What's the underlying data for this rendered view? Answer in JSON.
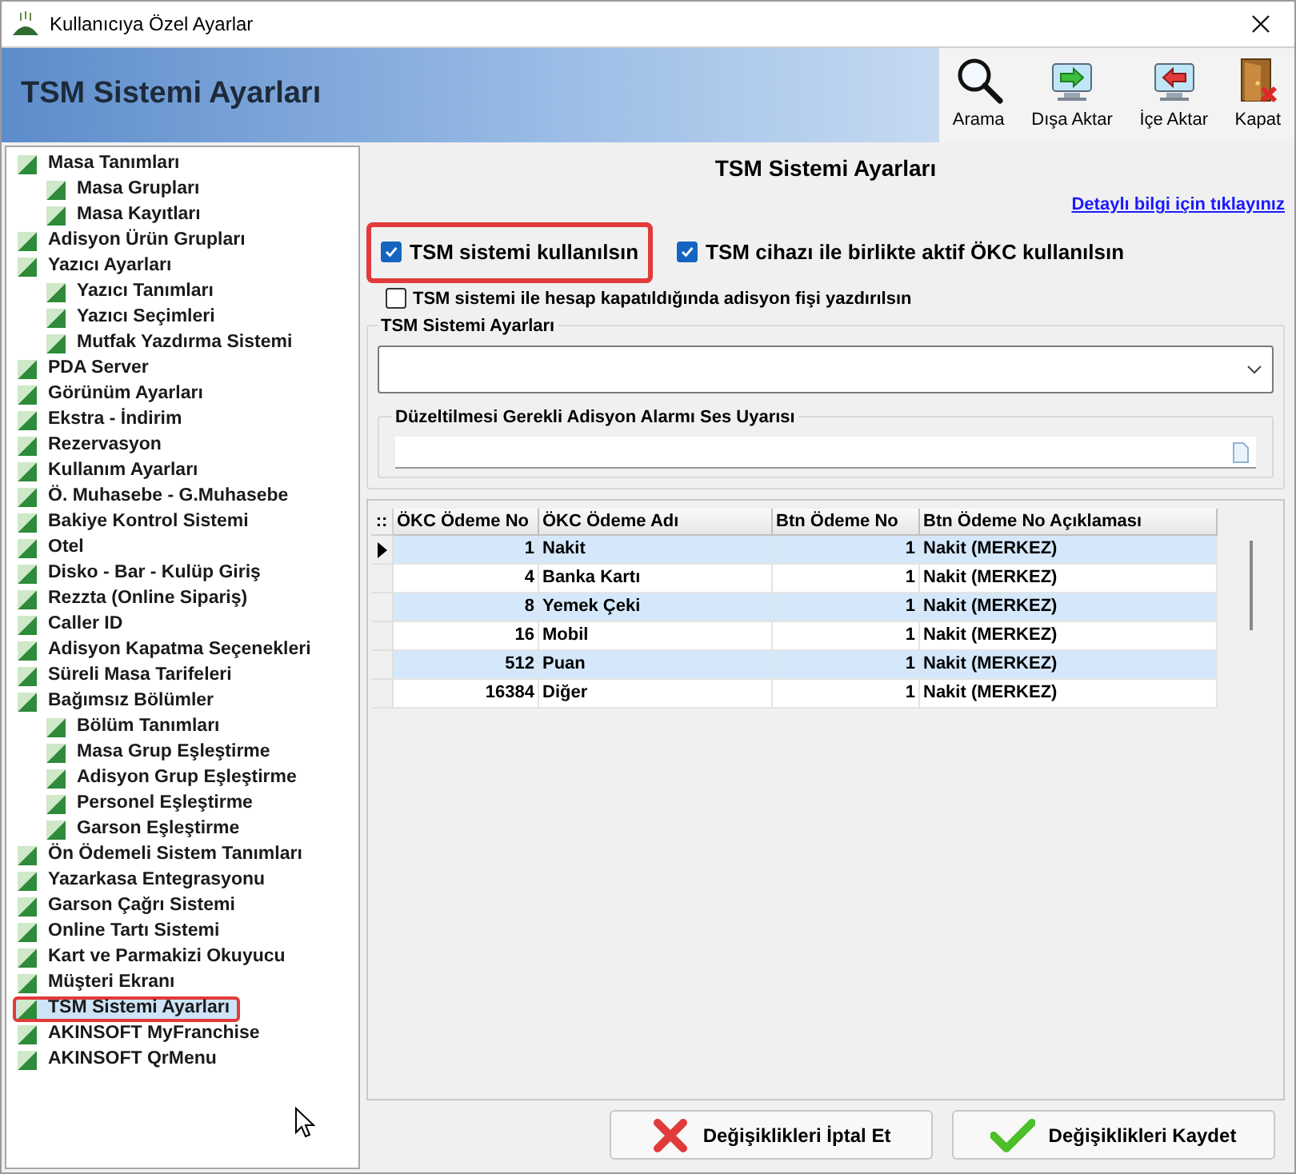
{
  "window": {
    "title": "Kullanıcıya Özel Ayarlar"
  },
  "header": {
    "title": "TSM Sistemi Ayarları"
  },
  "toolbar": [
    {
      "kind": "search",
      "label": "Arama"
    },
    {
      "kind": "export",
      "label": "Dışa Aktar"
    },
    {
      "kind": "import",
      "label": "İçe Aktar"
    },
    {
      "kind": "close",
      "label": "Kapat"
    }
  ],
  "sidebar": {
    "items": [
      {
        "label": "Masa Tanımları",
        "selected": false,
        "children": [
          {
            "label": "Masa Grupları",
            "selected": false
          },
          {
            "label": "Masa Kayıtları",
            "selected": false
          }
        ]
      },
      {
        "label": "Adisyon Ürün Grupları",
        "selected": false
      },
      {
        "label": "Yazıcı Ayarları",
        "selected": false,
        "children": [
          {
            "label": "Yazıcı Tanımları",
            "selected": false
          },
          {
            "label": "Yazıcı Seçimleri",
            "selected": false
          },
          {
            "label": "Mutfak Yazdırma Sistemi",
            "selected": false
          }
        ]
      },
      {
        "label": "PDA Server",
        "selected": false
      },
      {
        "label": "Görünüm Ayarları",
        "selected": false
      },
      {
        "label": "Ekstra - İndirim",
        "selected": false
      },
      {
        "label": "Rezervasyon",
        "selected": false
      },
      {
        "label": "Kullanım Ayarları",
        "selected": false
      },
      {
        "label": "Ö. Muhasebe - G.Muhasebe",
        "selected": false
      },
      {
        "label": "Bakiye Kontrol Sistemi",
        "selected": false
      },
      {
        "label": "Otel",
        "selected": false
      },
      {
        "label": "Disko - Bar - Kulüp Giriş",
        "selected": false
      },
      {
        "label": "Rezzta (Online Sipariş)",
        "selected": false
      },
      {
        "label": "Caller ID",
        "selected": false
      },
      {
        "label": "Adisyon Kapatma Seçenekleri",
        "selected": false
      },
      {
        "label": "Süreli Masa Tarifeleri",
        "selected": false
      },
      {
        "label": "Bağımsız Bölümler",
        "selected": false,
        "children": [
          {
            "label": "Bölüm Tanımları",
            "selected": false
          },
          {
            "label": "Masa Grup Eşleştirme",
            "selected": false
          },
          {
            "label": "Adisyon Grup Eşleştirme",
            "selected": false
          },
          {
            "label": "Personel Eşleştirme",
            "selected": false
          },
          {
            "label": "Garson Eşleştirme",
            "selected": false
          }
        ]
      },
      {
        "label": "Ön Ödemeli Sistem Tanımları",
        "selected": false
      },
      {
        "label": "Yazarkasa Entegrasyonu",
        "selected": false
      },
      {
        "label": "Garson Çağrı Sistemi",
        "selected": false
      },
      {
        "label": "Online Tartı Sistemi",
        "selected": false
      },
      {
        "label": "Kart ve Parmakizi Okuyucu",
        "selected": false
      },
      {
        "label": "Müşteri Ekranı",
        "selected": false
      },
      {
        "label": "TSM Sistemi Ayarları",
        "selected": true
      },
      {
        "label": "AKINSOFT MyFranchise",
        "selected": false
      },
      {
        "label": "AKINSOFT QrMenu",
        "selected": false
      }
    ]
  },
  "panel": {
    "title": "TSM Sistemi Ayarları",
    "link": "Detaylı bilgi için tıklayınız",
    "checkboxes": [
      {
        "label": "TSM sistemi kullanılsın",
        "checked": true,
        "highlighted": true
      },
      {
        "label": "TSM cihazı ile birlikte aktif ÖKC kullanılsın",
        "checked": true,
        "highlighted": false
      }
    ],
    "print_checkbox": {
      "label": "TSM sistemi ile hesap kapatıldığında adisyon fişi yazdırılsın",
      "checked": false
    },
    "group_title": "TSM Sistemi Ayarları",
    "alarm_group_title": "Düzeltilmesi Gerekli Adisyon Alarmı Ses Uyarısı"
  },
  "table": {
    "corner": "::",
    "columns": [
      "ÖKC Ödeme No",
      "ÖKC Ödeme Adı",
      "Btn Ödeme No",
      "Btn Ödeme No Açıklaması"
    ],
    "rows": [
      {
        "cells": [
          "1",
          "Nakit",
          "1",
          "Nakit (MERKEZ)"
        ],
        "selected": true
      },
      {
        "cells": [
          "4",
          "Banka Kartı",
          "1",
          "Nakit (MERKEZ)"
        ],
        "selected": false
      },
      {
        "cells": [
          "8",
          "Yemek Çeki",
          "1",
          "Nakit (MERKEZ)"
        ],
        "selected": false
      },
      {
        "cells": [
          "16",
          "Mobil",
          "1",
          "Nakit (MERKEZ)"
        ],
        "selected": false
      },
      {
        "cells": [
          "512",
          "Puan",
          "1",
          "Nakit (MERKEZ)"
        ],
        "selected": false
      },
      {
        "cells": [
          "16384",
          "Diğer",
          "1",
          "Nakit (MERKEZ)"
        ],
        "selected": false
      }
    ]
  },
  "buttons": [
    {
      "kind": "cancel",
      "label": "Değişiklikleri İptal Et"
    },
    {
      "kind": "save",
      "label": "Değişiklikleri Kaydet"
    }
  ]
}
